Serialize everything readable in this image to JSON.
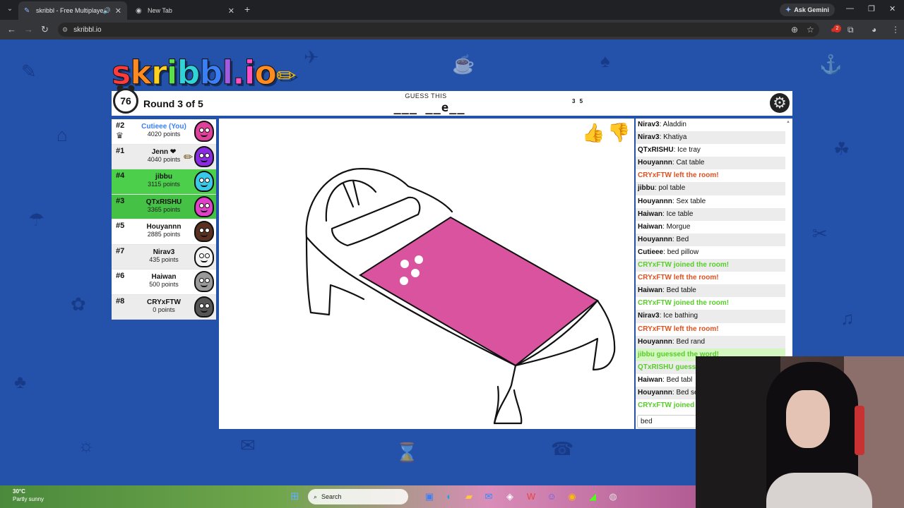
{
  "browser": {
    "tabs": [
      {
        "title": "skribbl - Free Multiplayer D",
        "active": true
      },
      {
        "title": "New Tab",
        "active": false
      }
    ],
    "gemini_label": "Ask Gemini",
    "url": "skribbl.io",
    "extension_badge": "2"
  },
  "game": {
    "logo": "skribbl.io",
    "timer": "76",
    "round_text": "Round 3 of 5",
    "guess_label": "GUESS THIS",
    "word_hint": "___ __e__",
    "word_lengths": "3 5",
    "players": [
      {
        "rank": "#2",
        "name": "Cutieee (You)",
        "points": "4020 points",
        "me": true,
        "guessed": false,
        "crown": true,
        "drawing": false,
        "avatar_color": "#e0409a"
      },
      {
        "rank": "#1",
        "name": "Jenn ❤",
        "points": "4040 points",
        "me": false,
        "guessed": false,
        "crown": false,
        "drawing": true,
        "avatar_color": "#8a2be2"
      },
      {
        "rank": "#4",
        "name": "jibbu",
        "points": "3115 points",
        "me": false,
        "guessed": true,
        "crown": false,
        "drawing": false,
        "avatar_color": "#38c9e8"
      },
      {
        "rank": "#3",
        "name": "QTxRISHU",
        "points": "3365 points",
        "me": false,
        "guessed": true,
        "crown": false,
        "drawing": false,
        "avatar_color": "#e040c8"
      },
      {
        "rank": "#5",
        "name": "Houyannn",
        "points": "2885 points",
        "me": false,
        "guessed": false,
        "crown": false,
        "drawing": false,
        "avatar_color": "#5a3020"
      },
      {
        "rank": "#7",
        "name": "Nirav3",
        "points": "435 points",
        "me": false,
        "guessed": false,
        "crown": false,
        "drawing": false,
        "avatar_color": "#f4f4f4"
      },
      {
        "rank": "#6",
        "name": "Haiwan",
        "points": "500 points",
        "me": false,
        "guessed": false,
        "crown": false,
        "drawing": false,
        "avatar_color": "#9a9a9a"
      },
      {
        "rank": "#8",
        "name": "CRYxFTW",
        "points": "0 points",
        "me": false,
        "guessed": false,
        "crown": false,
        "drawing": false,
        "avatar_color": "#555555"
      }
    ],
    "chat": [
      {
        "user": "Nirav3",
        "text": "Aladdin",
        "type": "msg"
      },
      {
        "user": "Nirav3",
        "text": "Khatiya",
        "type": "msg"
      },
      {
        "user": "QTxRISHU",
        "text": "Ice tray",
        "type": "msg"
      },
      {
        "user": "Houyannn",
        "text": "Cat table",
        "type": "msg"
      },
      {
        "user": "",
        "text": "CRYxFTW left the room!",
        "type": "sys-red"
      },
      {
        "user": "jibbu",
        "text": "pol table",
        "type": "msg"
      },
      {
        "user": "Houyannn",
        "text": "Sex table",
        "type": "msg"
      },
      {
        "user": "Haiwan",
        "text": "Ice table",
        "type": "msg"
      },
      {
        "user": "Haiwan",
        "text": "Morgue",
        "type": "msg"
      },
      {
        "user": "Houyannn",
        "text": "Bed",
        "type": "msg"
      },
      {
        "user": "Cutieee",
        "text": "bed pillow",
        "type": "msg"
      },
      {
        "user": "",
        "text": "CRYxFTW joined the room!",
        "type": "sys-green"
      },
      {
        "user": "",
        "text": "CRYxFTW left the room!",
        "type": "sys-red"
      },
      {
        "user": "Haiwan",
        "text": "Bed table",
        "type": "msg"
      },
      {
        "user": "",
        "text": "CRYxFTW joined the room!",
        "type": "sys-green"
      },
      {
        "user": "Nirav3",
        "text": "Ice bathing",
        "type": "msg"
      },
      {
        "user": "",
        "text": "CRYxFTW left the room!",
        "type": "sys-red"
      },
      {
        "user": "Houyannn",
        "text": "Bed rand",
        "type": "msg"
      },
      {
        "user": "",
        "text": "jibbu guessed the word!",
        "type": "sys-guess"
      },
      {
        "user": "",
        "text": "QTxRISHU guess",
        "type": "sys-green"
      },
      {
        "user": "Haiwan",
        "text": "Bed tabl",
        "type": "msg"
      },
      {
        "user": "Houyannn",
        "text": "Bed se",
        "type": "msg"
      },
      {
        "user": "",
        "text": "CRYxFTW joined",
        "type": "sys-green"
      }
    ],
    "chat_input_value": "bed",
    "colors": {
      "blanket": "#d9539e",
      "guessed_row": "#4cd04c",
      "me_name": "#3a7ff6"
    }
  },
  "taskbar": {
    "weather_temp": "30°C",
    "weather_desc": "Partly sunny",
    "search_label": "Search"
  }
}
